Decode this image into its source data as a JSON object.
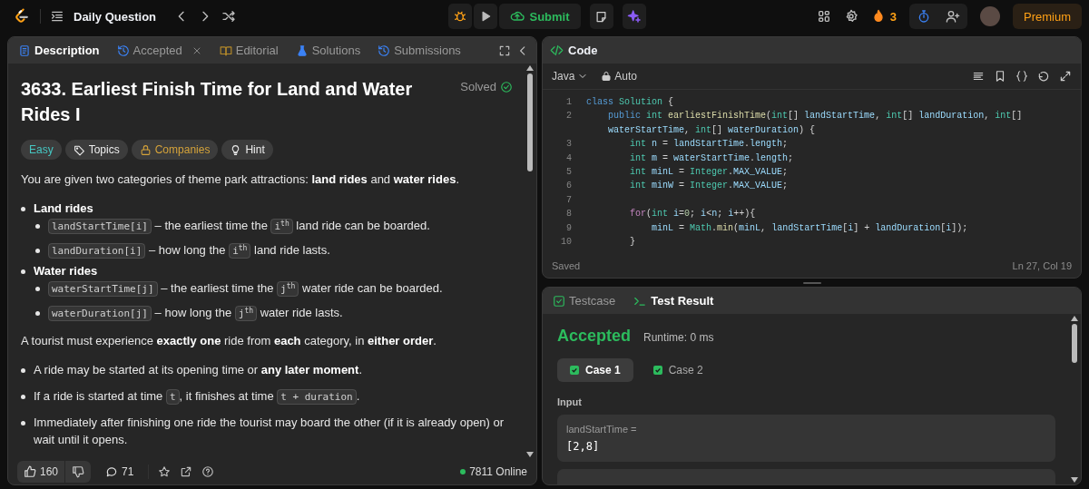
{
  "topbar": {
    "title": "Daily Question",
    "submit": "Submit",
    "streak": "3",
    "premium": "Premium"
  },
  "left_panel": {
    "tabs": [
      {
        "label": "Description",
        "selected": true,
        "kind": "description",
        "closable": false
      },
      {
        "label": "Accepted",
        "selected": false,
        "kind": "accepted",
        "closable": true
      },
      {
        "label": "Editorial",
        "selected": false,
        "kind": "editorial",
        "closable": false
      },
      {
        "label": "Solutions",
        "selected": false,
        "kind": "solutions",
        "closable": false
      },
      {
        "label": "Submissions",
        "selected": false,
        "kind": "submissions",
        "closable": false
      }
    ],
    "problem": {
      "title": "3633. Earliest Finish Time for Land and Water Rides I",
      "status": "Solved",
      "tags": [
        {
          "label": "Easy",
          "kind": "difficulty"
        },
        {
          "label": "Topics",
          "kind": "topics"
        },
        {
          "label": "Companies",
          "kind": "companies"
        },
        {
          "label": "Hint",
          "kind": "hint"
        }
      ],
      "description": [
        {
          "kind": "paragraph",
          "segments": [
            {
              "kind": "text",
              "text": "You are given two categories of theme park attractions: **land rides** and **water rides**."
            }
          ]
        },
        {
          "kind": "list",
          "items": [
            {
              "segments": [
                {
                  "kind": "text",
                  "text": "Land rides"
                }
              ],
              "children": [
                {
                  "segments": [
                    {
                      "kind": "code",
                      "text": "landStartTime[i]"
                    },
                    {
                      "kind": "text",
                      "text": " – the earliest time the "
                    },
                    {
                      "kind": "code",
                      "text": "i$^{th}$"
                    },
                    {
                      "kind": "text",
                      "text": " land ride can be boarded."
                    }
                  ]
                },
                {
                  "segments": [
                    {
                      "kind": "code",
                      "text": "landDuration[i]"
                    },
                    {
                      "kind": "text",
                      "text": " – how long the "
                    },
                    {
                      "kind": "code",
                      "text": "i$^{th}$"
                    },
                    {
                      "kind": "text",
                      "text": " land ride lasts."
                    }
                  ]
                }
              ]
            },
            {
              "segments": [
                {
                  "kind": "text",
                  "text": "Water rides"
                }
              ],
              "children": [
                {
                  "segments": [
                    {
                      "kind": "code",
                      "text": "waterStartTime[j]"
                    },
                    {
                      "kind": "text",
                      "text": " – the earliest time the "
                    },
                    {
                      "kind": "code",
                      "text": "j$^{th}$"
                    },
                    {
                      "kind": "text",
                      "text": " water ride can be boarded."
                    }
                  ]
                },
                {
                  "segments": [
                    {
                      "kind": "code",
                      "text": "waterDuration[j]"
                    },
                    {
                      "kind": "text",
                      "text": " – how long the "
                    },
                    {
                      "kind": "code",
                      "text": "j$^{th}$"
                    },
                    {
                      "kind": "text",
                      "text": " water ride lasts."
                    }
                  ]
                }
              ]
            }
          ]
        },
        {
          "kind": "paragraph",
          "segments": [
            {
              "kind": "text",
              "text": "A tourist must experience **exactly one** ride from **each** category, in **either order**."
            }
          ]
        },
        {
          "kind": "list",
          "items": [
            {
              "segments": [
                {
                  "kind": "text",
                  "text": "A ride may be started at its opening time or **any later moment**."
                }
              ]
            },
            {
              "segments": [
                {
                  "kind": "text",
                  "text": "If a ride is started at time "
                },
                {
                  "kind": "code",
                  "text": "t"
                },
                {
                  "kind": "text",
                  "text": ", it finishes at time "
                },
                {
                  "kind": "code",
                  "text": "t + duration"
                },
                {
                  "kind": "text",
                  "text": "."
                }
              ]
            },
            {
              "segments": [
                {
                  "kind": "text",
                  "text": "Immediately after finishing one ride the tourist may board the other (if it is already open) or wait until it opens."
                }
              ]
            }
          ]
        }
      ]
    },
    "footer": {
      "likes": "160",
      "comments": "71",
      "online": "7811 Online"
    }
  },
  "editor": {
    "title": "Code",
    "language": "Java",
    "mode": "Auto",
    "status": "Saved",
    "cursor": "Ln 27, Col 19",
    "lines": [
      {
        "number": "1",
        "rows": [
          {
            "tokens": [
              {
                "kind": "kw",
                "text": "class "
              },
              {
                "kind": "ty",
                "text": "Solution"
              },
              {
                "kind": "p",
                "text": " {"
              }
            ]
          }
        ]
      },
      {
        "number": "2",
        "rows": [
          {
            "tokens": [
              {
                "kind": "kw",
                "text": "    public "
              },
              {
                "kind": "ty",
                "text": "int "
              },
              {
                "kind": "fn",
                "text": "earliestFinishTime"
              },
              {
                "kind": "p",
                "text": "("
              },
              {
                "kind": "ty",
                "text": "int"
              },
              {
                "kind": "p",
                "text": "[] "
              },
              {
                "kind": "var",
                "text": "landStartTime"
              },
              {
                "kind": "p",
                "text": ", "
              },
              {
                "kind": "ty",
                "text": "int"
              },
              {
                "kind": "p",
                "text": "[] "
              },
              {
                "kind": "var",
                "text": "landDuration"
              },
              {
                "kind": "p",
                "text": ", "
              },
              {
                "kind": "ty",
                "text": "int"
              },
              {
                "kind": "p",
                "text": "[]"
              }
            ]
          },
          {
            "tokens": [
              {
                "kind": "var",
                "text": "    waterStartTime"
              },
              {
                "kind": "p",
                "text": ", "
              },
              {
                "kind": "ty",
                "text": "int"
              },
              {
                "kind": "p",
                "text": "[] "
              },
              {
                "kind": "var",
                "text": "waterDuration"
              },
              {
                "kind": "p",
                "text": ") {"
              }
            ]
          }
        ]
      },
      {
        "number": "3",
        "rows": [
          {
            "tokens": [
              {
                "kind": "ty",
                "text": "        int "
              },
              {
                "kind": "var",
                "text": "n"
              },
              {
                "kind": "p",
                "text": " = "
              },
              {
                "kind": "var",
                "text": "landStartTime"
              },
              {
                "kind": "p",
                "text": "."
              },
              {
                "kind": "var",
                "text": "length"
              },
              {
                "kind": "p",
                "text": ";"
              }
            ]
          }
        ]
      },
      {
        "number": "4",
        "rows": [
          {
            "tokens": [
              {
                "kind": "ty",
                "text": "        int "
              },
              {
                "kind": "var",
                "text": "m"
              },
              {
                "kind": "p",
                "text": " = "
              },
              {
                "kind": "var",
                "text": "waterStartTime"
              },
              {
                "kind": "p",
                "text": "."
              },
              {
                "kind": "var",
                "text": "length"
              },
              {
                "kind": "p",
                "text": ";"
              }
            ]
          }
        ]
      },
      {
        "number": "5",
        "rows": [
          {
            "tokens": [
              {
                "kind": "ty",
                "text": "        int "
              },
              {
                "kind": "var",
                "text": "minL"
              },
              {
                "kind": "p",
                "text": " = "
              },
              {
                "kind": "ty",
                "text": "Integer"
              },
              {
                "kind": "p",
                "text": "."
              },
              {
                "kind": "var",
                "text": "MAX_VALUE"
              },
              {
                "kind": "p",
                "text": ";"
              }
            ]
          }
        ]
      },
      {
        "number": "6",
        "rows": [
          {
            "tokens": [
              {
                "kind": "ty",
                "text": "        int "
              },
              {
                "kind": "var",
                "text": "minW"
              },
              {
                "kind": "p",
                "text": " = "
              },
              {
                "kind": "ty",
                "text": "Integer"
              },
              {
                "kind": "p",
                "text": "."
              },
              {
                "kind": "var",
                "text": "MAX_VALUE"
              },
              {
                "kind": "p",
                "text": ";"
              }
            ]
          }
        ]
      },
      {
        "number": "7",
        "rows": [
          {
            "tokens": []
          }
        ]
      },
      {
        "number": "8",
        "rows": [
          {
            "tokens": [
              {
                "kind": "ctl",
                "text": "        for"
              },
              {
                "kind": "p",
                "text": "("
              },
              {
                "kind": "ty",
                "text": "int "
              },
              {
                "kind": "var",
                "text": "i"
              },
              {
                "kind": "p",
                "text": "="
              },
              {
                "kind": "num",
                "text": "0"
              },
              {
                "kind": "p",
                "text": "; "
              },
              {
                "kind": "var",
                "text": "i"
              },
              {
                "kind": "p",
                "text": "<"
              },
              {
                "kind": "var",
                "text": "n"
              },
              {
                "kind": "p",
                "text": "; "
              },
              {
                "kind": "var",
                "text": "i"
              },
              {
                "kind": "p",
                "text": "++){"
              }
            ]
          }
        ]
      },
      {
        "number": "9",
        "rows": [
          {
            "tokens": [
              {
                "kind": "var",
                "text": "            minL"
              },
              {
                "kind": "p",
                "text": " = "
              },
              {
                "kind": "ty",
                "text": "Math"
              },
              {
                "kind": "p",
                "text": "."
              },
              {
                "kind": "fn",
                "text": "min"
              },
              {
                "kind": "p",
                "text": "("
              },
              {
                "kind": "var",
                "text": "minL"
              },
              {
                "kind": "p",
                "text": ", "
              },
              {
                "kind": "var",
                "text": "landStartTime"
              },
              {
                "kind": "p",
                "text": "["
              },
              {
                "kind": "var",
                "text": "i"
              },
              {
                "kind": "p",
                "text": "] + "
              },
              {
                "kind": "var",
                "text": "landDuration"
              },
              {
                "kind": "p",
                "text": "["
              },
              {
                "kind": "var",
                "text": "i"
              },
              {
                "kind": "p",
                "text": "]);"
              }
            ]
          }
        ]
      },
      {
        "number": "10",
        "rows": [
          {
            "tokens": [
              {
                "kind": "p",
                "text": "        }"
              }
            ]
          }
        ]
      }
    ]
  },
  "results": {
    "tabs": [
      {
        "label": "Testcase",
        "selected": false,
        "kind": "testcase"
      },
      {
        "label": "Test Result",
        "selected": true,
        "kind": "result"
      }
    ],
    "verdict": "Accepted",
    "runtime": "Runtime: 0 ms",
    "cases": [
      {
        "label": "Case 1",
        "selected": true,
        "passed": true
      },
      {
        "label": "Case 2",
        "selected": false,
        "passed": true
      }
    ],
    "input_label": "Input",
    "inputs": [
      {
        "name": "landStartTime =",
        "value": "[2,8]"
      }
    ]
  }
}
